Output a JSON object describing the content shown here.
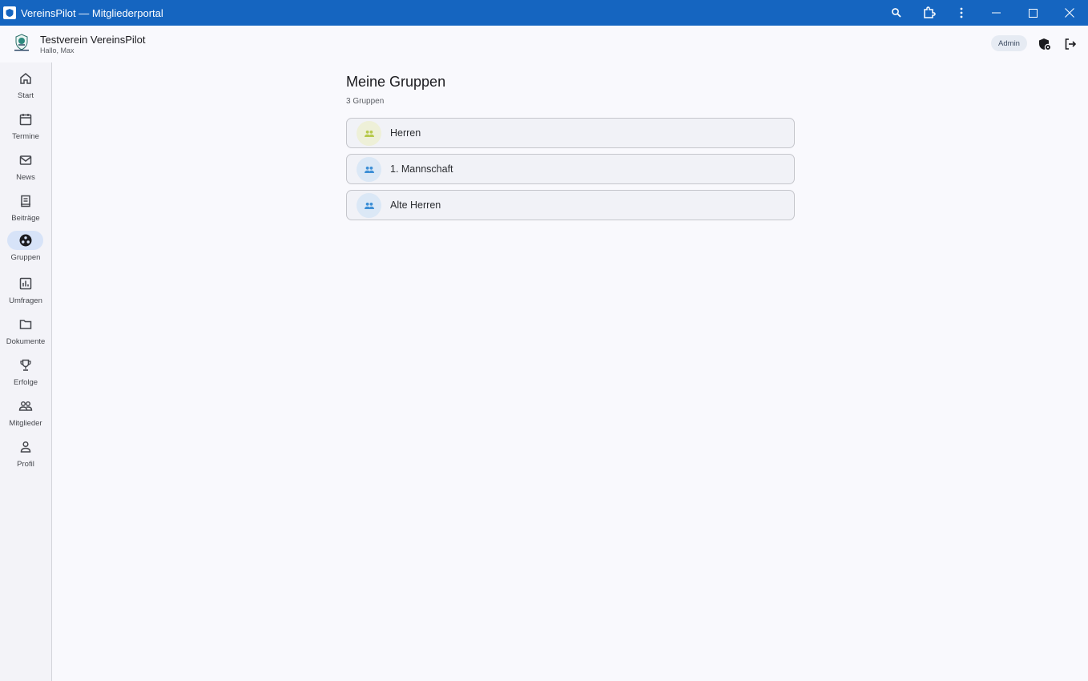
{
  "window": {
    "title": "VereinsPilot — Mitgliederportal"
  },
  "header": {
    "club_name": "Testverein VereinsPilot",
    "greeting": "Hallo, Max",
    "role_badge": "Admin"
  },
  "sidebar": {
    "items": [
      {
        "label": "Start",
        "icon": "home-icon"
      },
      {
        "label": "Termine",
        "icon": "calendar-icon"
      },
      {
        "label": "News",
        "icon": "mail-icon"
      },
      {
        "label": "Beiträge",
        "icon": "receipt-icon"
      },
      {
        "label": "Gruppen",
        "icon": "groups-icon",
        "active": true
      },
      {
        "label": "Umfragen",
        "icon": "poll-icon"
      },
      {
        "label": "Dokumente",
        "icon": "folder-icon"
      },
      {
        "label": "Erfolge",
        "icon": "trophy-icon"
      },
      {
        "label": "Mitglieder",
        "icon": "members-icon"
      },
      {
        "label": "Profil",
        "icon": "person-icon"
      }
    ]
  },
  "main": {
    "title": "Meine Gruppen",
    "subtitle": "3 Gruppen",
    "groups": [
      {
        "name": "Herren",
        "avatar_bg": "#eef0d8",
        "icon_color": "#b7c94a"
      },
      {
        "name": "1. Mannschaft",
        "avatar_bg": "#dbe8f6",
        "icon_color": "#3d8fd6"
      },
      {
        "name": "Alte Herren",
        "avatar_bg": "#dbe8f6",
        "icon_color": "#3d8fd6"
      }
    ]
  },
  "colors": {
    "titlebar": "#1565c0",
    "active_nav": "#d7e3f8"
  }
}
